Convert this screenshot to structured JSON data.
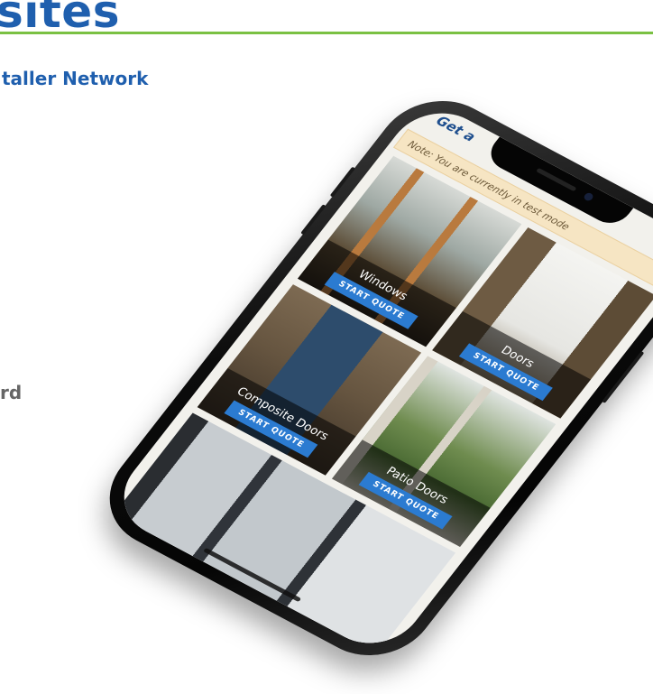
{
  "background": {
    "title_fragment": "sites",
    "subheading_fragment": "taller Network",
    "side_fragment": "rd"
  },
  "phone": {
    "header_fragment": "Get a",
    "notice_text": "Note: You are currently in test mode",
    "notice_close": "×",
    "tiles": [
      {
        "label": "Windows",
        "button": "START QUOTE"
      },
      {
        "label": "Doors",
        "button": "START QUOTE"
      },
      {
        "label": "Composite Doors",
        "button": "START QUOTE"
      },
      {
        "label": "Patio Doors",
        "button": "START QUOTE"
      }
    ]
  },
  "colors": {
    "brand_blue": "#1f5fae",
    "accent_green": "#7ac143",
    "button_blue": "#2b7bd1",
    "notice_bg": "#f6e5c3"
  }
}
